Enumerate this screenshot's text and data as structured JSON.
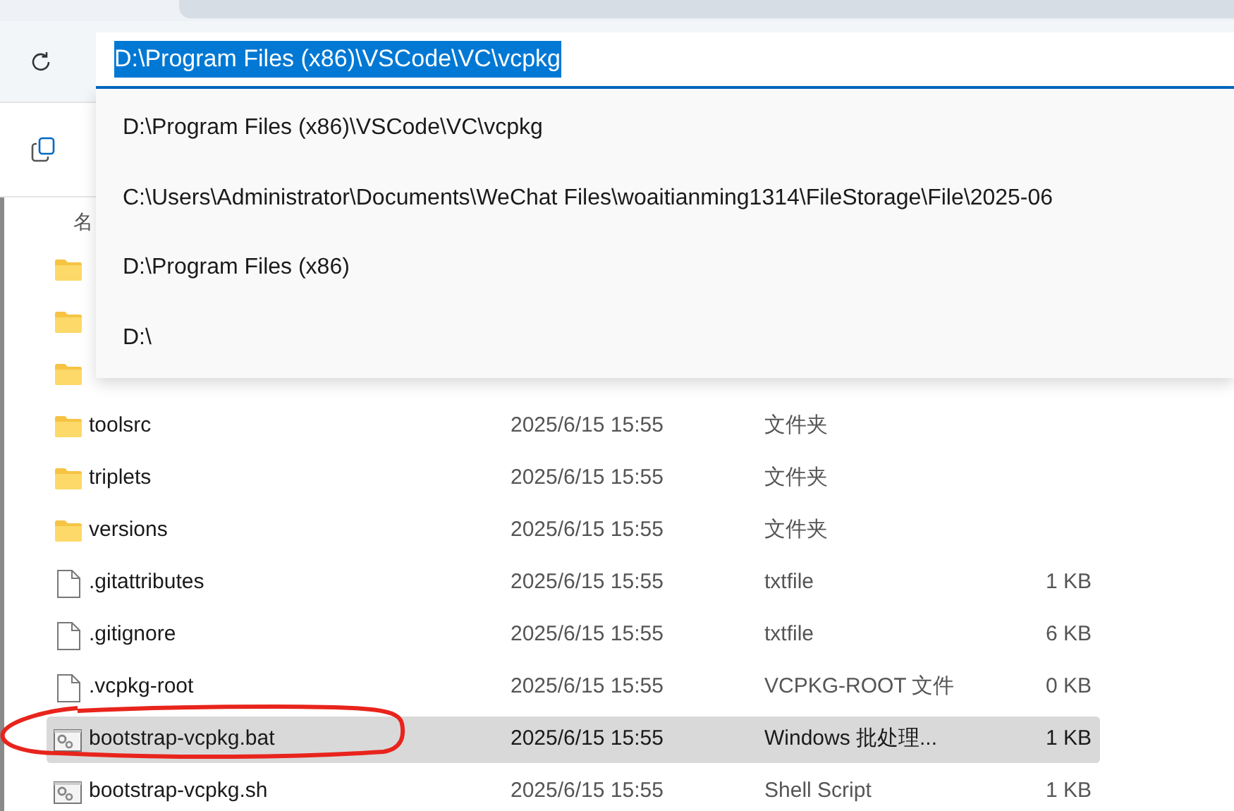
{
  "address_bar": {
    "value": "D:\\Program Files (x86)\\VSCode\\VC\\vcpkg",
    "text_selected": true
  },
  "suggestions": [
    "D:\\Program Files (x86)\\VSCode\\VC\\vcpkg",
    "C:\\Users\\Administrator\\Documents\\WeChat Files\\woaitianming1314\\FileStorage\\File\\2025-06",
    "D:\\Program Files (x86)",
    "D:\\"
  ],
  "file_list": {
    "header": "名",
    "rows": [
      {
        "kind": "folder",
        "selected": false
      },
      {
        "kind": "folder",
        "selected": false
      },
      {
        "kind": "folder",
        "selected": false
      },
      {
        "kind": "folder",
        "name": "toolsrc",
        "date": "2025/6/15 15:55",
        "type": "文件夹",
        "selected": false
      },
      {
        "kind": "folder",
        "name": "triplets",
        "date": "2025/6/15 15:55",
        "type": "文件夹",
        "selected": false
      },
      {
        "kind": "folder",
        "name": "versions",
        "date": "2025/6/15 15:55",
        "type": "文件夹",
        "selected": false
      },
      {
        "kind": "file",
        "name": ".gitattributes",
        "date": "2025/6/15 15:55",
        "type": "txtfile",
        "size": "1 KB",
        "selected": false
      },
      {
        "kind": "file",
        "name": ".gitignore",
        "date": "2025/6/15 15:55",
        "type": "txtfile",
        "size": "6 KB",
        "selected": false
      },
      {
        "kind": "file",
        "name": ".vcpkg-root",
        "date": "2025/6/15 15:55",
        "type": "VCPKG-ROOT 文件",
        "size": "0 KB",
        "selected": false
      },
      {
        "kind": "script",
        "name": "bootstrap-vcpkg.bat",
        "date": "2025/6/15 15:55",
        "type": "Windows 批处理...",
        "size": "1 KB",
        "selected": true
      },
      {
        "kind": "script",
        "name": "bootstrap-vcpkg.sh",
        "date": "2025/6/15 15:55",
        "type": "Shell Script",
        "size": "1 KB",
        "selected": false
      }
    ]
  }
}
